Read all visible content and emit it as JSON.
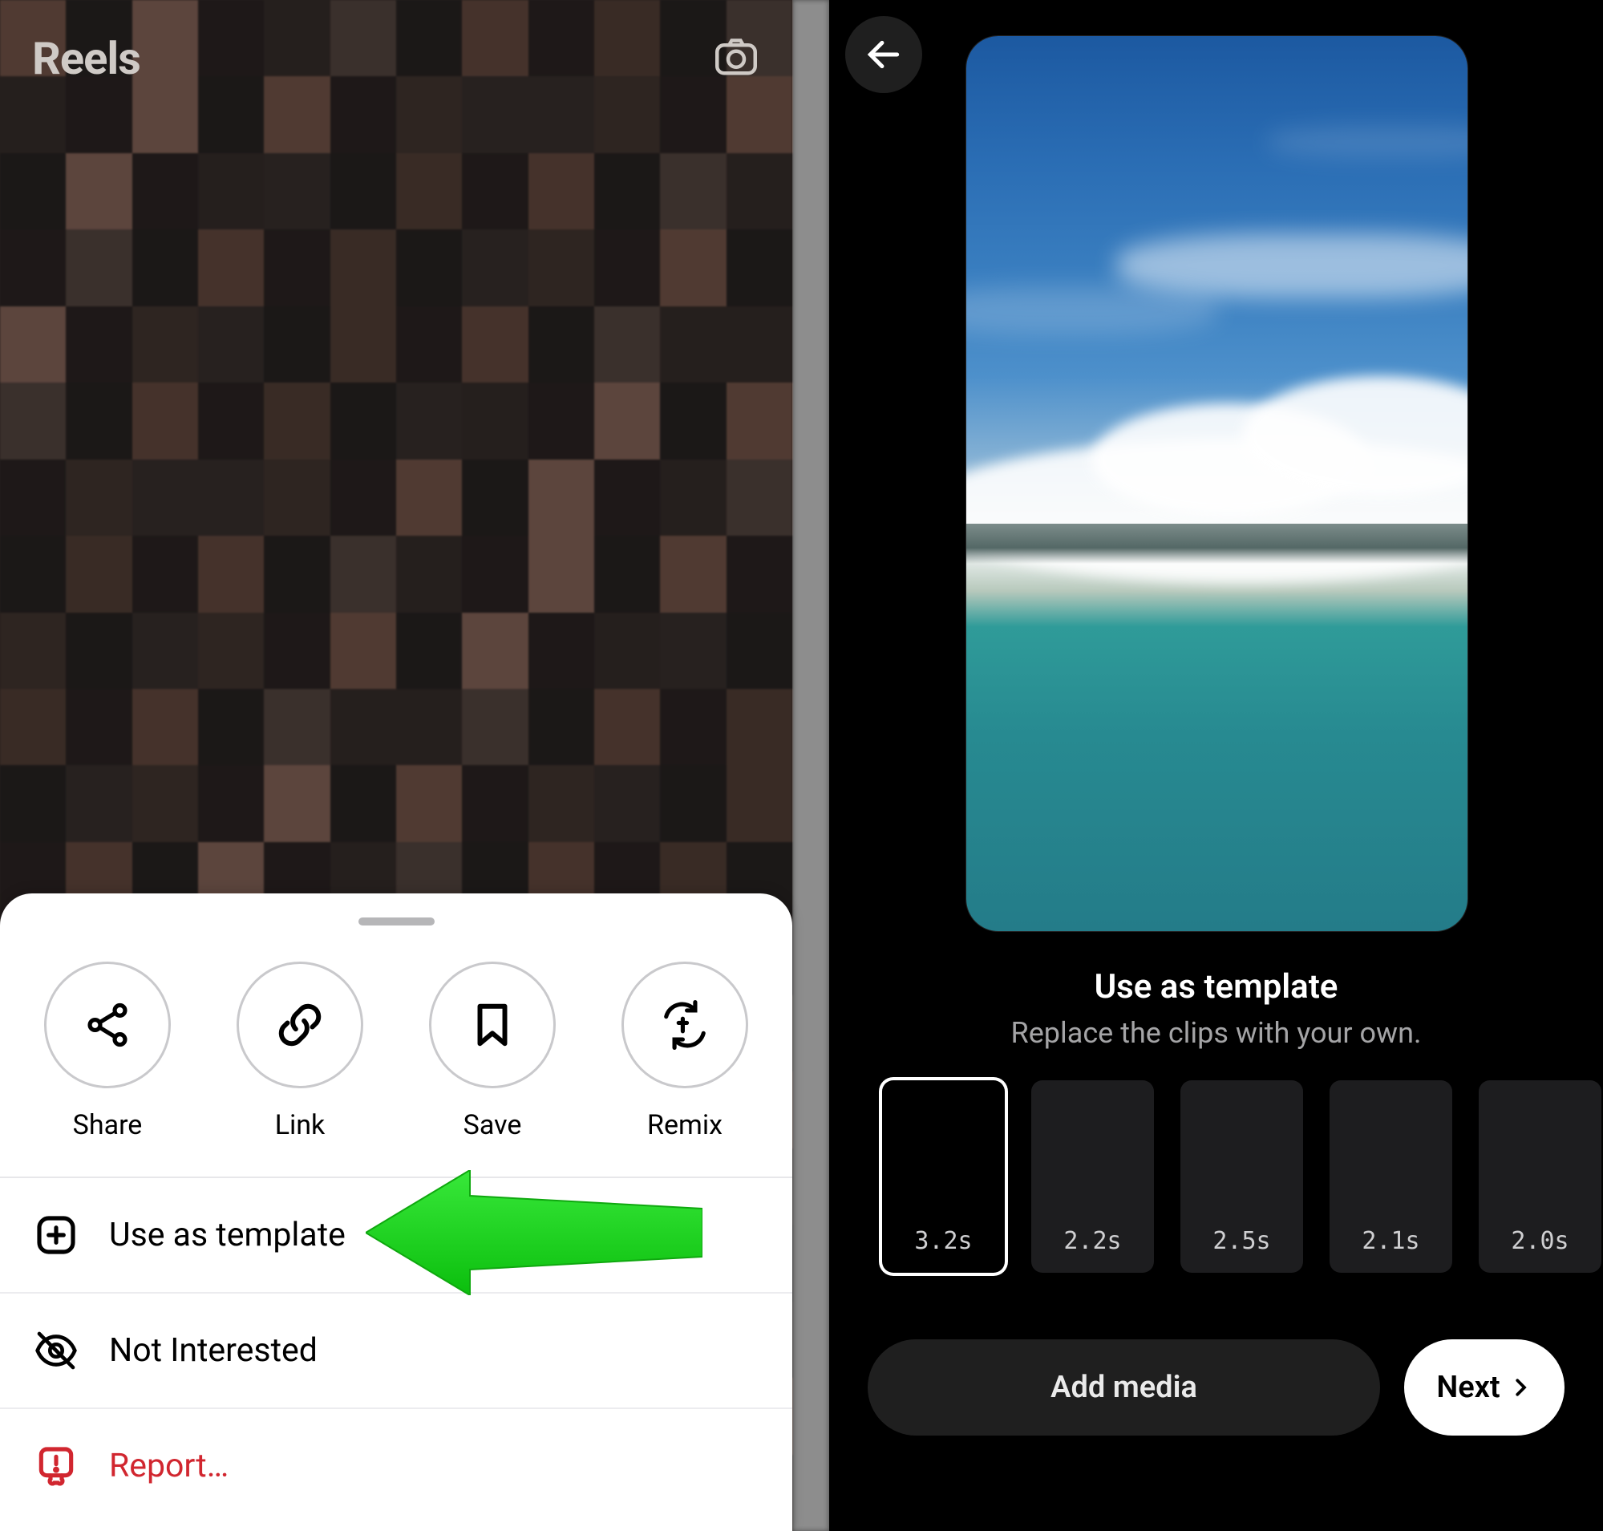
{
  "left": {
    "header_title": "Reels",
    "sheet": {
      "actions": [
        {
          "label": "Share",
          "icon": "share-icon"
        },
        {
          "label": "Link",
          "icon": "link-icon"
        },
        {
          "label": "Save",
          "icon": "save-icon"
        },
        {
          "label": "Remix",
          "icon": "remix-icon"
        }
      ],
      "use_as_template_label": "Use as template",
      "not_interested_label": "Not Interested",
      "report_label": "Report…"
    }
  },
  "right": {
    "title": "Use as template",
    "subtitle": "Replace the clips with your own.",
    "clips": [
      {
        "duration": "3.2s",
        "selected": true
      },
      {
        "duration": "2.2s",
        "selected": false
      },
      {
        "duration": "2.5s",
        "selected": false
      },
      {
        "duration": "2.1s",
        "selected": false
      },
      {
        "duration": "2.0s",
        "selected": false
      }
    ],
    "add_media_label": "Add media",
    "next_label": "Next"
  },
  "colors": {
    "accent_red": "#d1262f",
    "arrow_green": "#18d61a"
  }
}
